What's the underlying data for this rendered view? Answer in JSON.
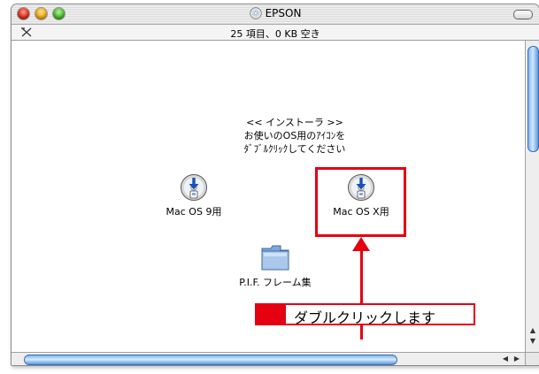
{
  "window": {
    "title": "EPSON",
    "status": "25 項目、0 KB 空き"
  },
  "installer": {
    "heading": "<< インストーラ >>",
    "line1": "お使いのOS用のｱｲｺﾝを",
    "line2": "ﾀﾞﾌﾞﾙｸﾘｯｸしてください"
  },
  "icons": [
    {
      "label": "Mac OS 9用",
      "icon": "installer-cd-icon"
    },
    {
      "label": "Mac OS X用",
      "icon": "installer-cd-icon"
    },
    {
      "label": "P.I.F. フレーム集",
      "icon": "folder-icon"
    }
  ],
  "callout": {
    "text": "ダブルクリックします"
  },
  "colors": {
    "annotation_red": "#e50012",
    "scroll_blue": "#5a98e0"
  }
}
